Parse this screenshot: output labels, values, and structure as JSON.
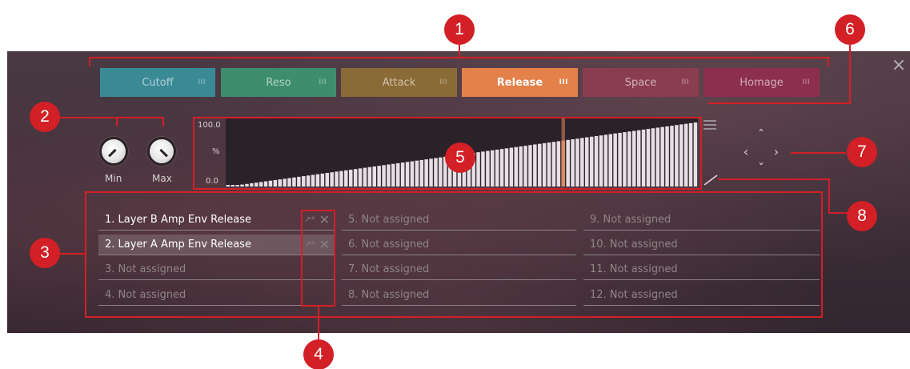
{
  "tabs": [
    {
      "label": "Cutoff",
      "color": "#3a8a96",
      "grip": "III"
    },
    {
      "label": "Reso",
      "color": "#3e8e6e",
      "grip": "III"
    },
    {
      "label": "Attack",
      "color": "#8a6a36",
      "grip": "III"
    },
    {
      "label": "Release",
      "color": "#e4804a",
      "grip": "III",
      "active": true
    },
    {
      "label": "Space",
      "color": "#8a3d4f",
      "grip": "III"
    },
    {
      "label": "Homage",
      "color": "#8c2f4e",
      "grip": "III"
    }
  ],
  "knobs": {
    "min_label": "Min",
    "max_label": "Max",
    "min_value": 0.0,
    "max_value": 1.0
  },
  "graph": {
    "y_max_label": "100.0",
    "y_unit_label": "%",
    "y_min_label": "0.0",
    "step_count": 100,
    "ramp_start": 0.0,
    "ramp_end": 1.0,
    "highlight_step_index": 71,
    "bar_color": "#e6e0e4",
    "highlight_color": "#d98a66"
  },
  "slots": [
    {
      "label": "1. Layer B Amp Env Release",
      "assigned": true
    },
    {
      "label": "2. Layer A Amp Env Release",
      "assigned": true,
      "selected": true
    },
    {
      "label": "3. Not assigned"
    },
    {
      "label": "4. Not assigned"
    },
    {
      "label": "5. Not assigned"
    },
    {
      "label": "6. Not assigned"
    },
    {
      "label": "7. Not assigned"
    },
    {
      "label": "8. Not assigned"
    },
    {
      "label": "9. Not assigned"
    },
    {
      "label": "10. Not assigned"
    },
    {
      "label": "11. Not assigned"
    },
    {
      "label": "12. Not assigned"
    }
  ],
  "icons": {
    "close": "×",
    "learn": "↗*",
    "remove": "✕",
    "up": "ˆ",
    "down": "ˇ",
    "left": "‹",
    "right": "›"
  },
  "callouts": [
    "1",
    "2",
    "3",
    "4",
    "5",
    "6",
    "7",
    "8"
  ],
  "accent_color": "#d31f26"
}
